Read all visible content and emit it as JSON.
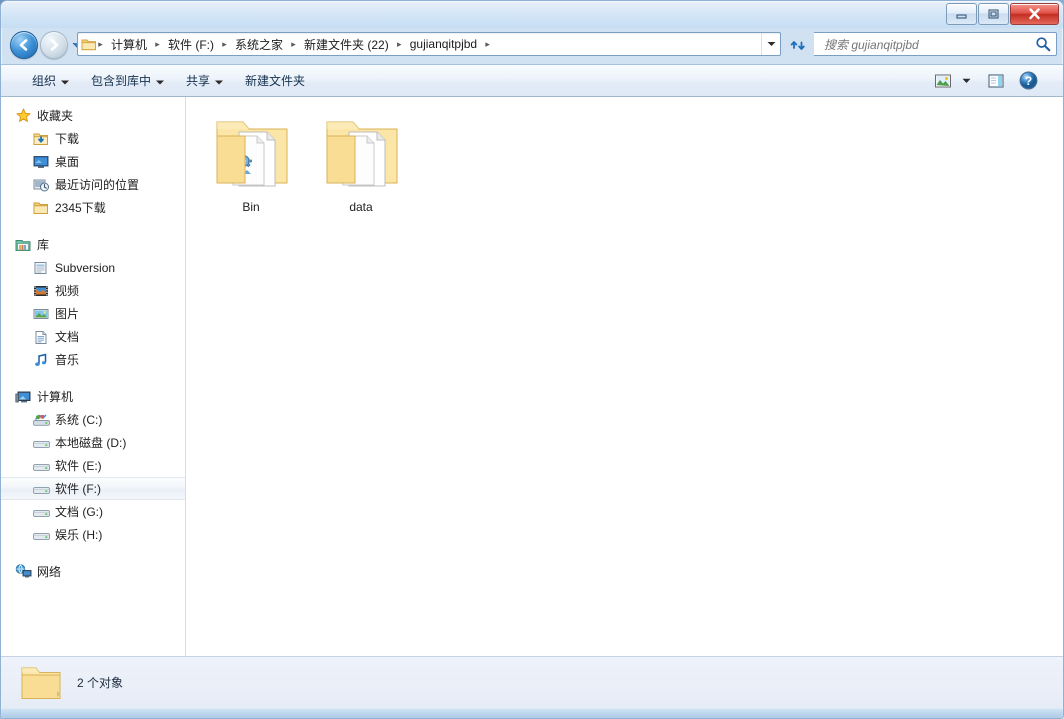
{
  "window": {
    "title": "",
    "controls": [
      {
        "name": "minimize-button",
        "glyph": "minimize"
      },
      {
        "name": "maximize-button",
        "glyph": "maximize"
      },
      {
        "name": "close-button",
        "glyph": "close"
      }
    ]
  },
  "navigation": {
    "back_label": "后退",
    "forward_label": "前进",
    "history_label": "最近浏览的位置",
    "refresh_label": "刷新",
    "breadcrumbs": [
      "计算机",
      "软件 (F:)",
      "系统之家",
      "新建文件夹 (22)",
      "gujianqitpjbd"
    ]
  },
  "search": {
    "placeholder": "搜索 gujianqitpjbd",
    "value": "",
    "icon": "search-icon"
  },
  "toolbar": {
    "items": [
      {
        "label": "组织",
        "has_menu": true,
        "name": "organize"
      },
      {
        "label": "包含到库中",
        "has_menu": true,
        "name": "include-in-library"
      },
      {
        "label": "共享",
        "has_menu": true,
        "name": "share-with"
      },
      {
        "label": "新建文件夹",
        "has_menu": false,
        "name": "new-folder"
      }
    ],
    "right_items": [
      {
        "name": "change-view",
        "icon": "view-layout-icon",
        "has_menu": true
      },
      {
        "name": "preview-pane",
        "icon": "preview-pane-icon",
        "has_menu": false
      },
      {
        "name": "help",
        "icon": "help-icon",
        "has_menu": false
      }
    ]
  },
  "sidebar": {
    "groups": [
      {
        "header": {
          "label": "收藏夹",
          "icon": "star-icon",
          "name": "favorites"
        },
        "items": [
          {
            "label": "下载",
            "icon": "downloads-folder-icon",
            "name": "downloads"
          },
          {
            "label": "桌面",
            "icon": "desktop-icon",
            "name": "desktop"
          },
          {
            "label": "最近访问的位置",
            "icon": "recent-places-icon",
            "name": "recent-places"
          },
          {
            "label": "2345下载",
            "icon": "folder-icon",
            "name": "2345-downloads"
          }
        ]
      },
      {
        "header": {
          "label": "库",
          "icon": "library-icon",
          "name": "libraries"
        },
        "items": [
          {
            "label": "Subversion",
            "icon": "subversion-icon",
            "name": "subversion"
          },
          {
            "label": "视频",
            "icon": "videos-icon",
            "name": "videos"
          },
          {
            "label": "图片",
            "icon": "pictures-icon",
            "name": "pictures"
          },
          {
            "label": "文档",
            "icon": "documents-icon",
            "name": "documents"
          },
          {
            "label": "音乐",
            "icon": "music-icon",
            "name": "music"
          }
        ]
      },
      {
        "header": {
          "label": "计算机",
          "icon": "computer-icon",
          "name": "computer"
        },
        "items": [
          {
            "label": "系统 (C:)",
            "icon": "system-drive-icon",
            "name": "drive-c",
            "selected": false
          },
          {
            "label": "本地磁盘 (D:)",
            "icon": "drive-icon",
            "name": "drive-d",
            "selected": false
          },
          {
            "label": "软件 (E:)",
            "icon": "drive-icon",
            "name": "drive-e",
            "selected": false
          },
          {
            "label": "软件 (F:)",
            "icon": "drive-icon",
            "name": "drive-f",
            "selected": true
          },
          {
            "label": "文档 (G:)",
            "icon": "drive-icon",
            "name": "drive-g",
            "selected": false
          },
          {
            "label": "娱乐 (H:)",
            "icon": "drive-icon",
            "name": "drive-h",
            "selected": false
          }
        ]
      },
      {
        "header": {
          "label": "网络",
          "icon": "network-icon",
          "name": "network"
        },
        "items": []
      }
    ]
  },
  "files": [
    {
      "label": "Bin",
      "icon": "folder-with-app-icon",
      "name": "folder-bin"
    },
    {
      "label": "data",
      "icon": "folder-with-docs-icon",
      "name": "folder-data"
    }
  ],
  "statusbar": {
    "text": "2 个对象",
    "icon": "folder-icon"
  },
  "colors": {
    "accent": "#1663a8",
    "frame": "#8fb2d4",
    "close_button": "#c32d21",
    "folder_yellow": "#fbdf9a",
    "selection": "#e9eff7"
  }
}
